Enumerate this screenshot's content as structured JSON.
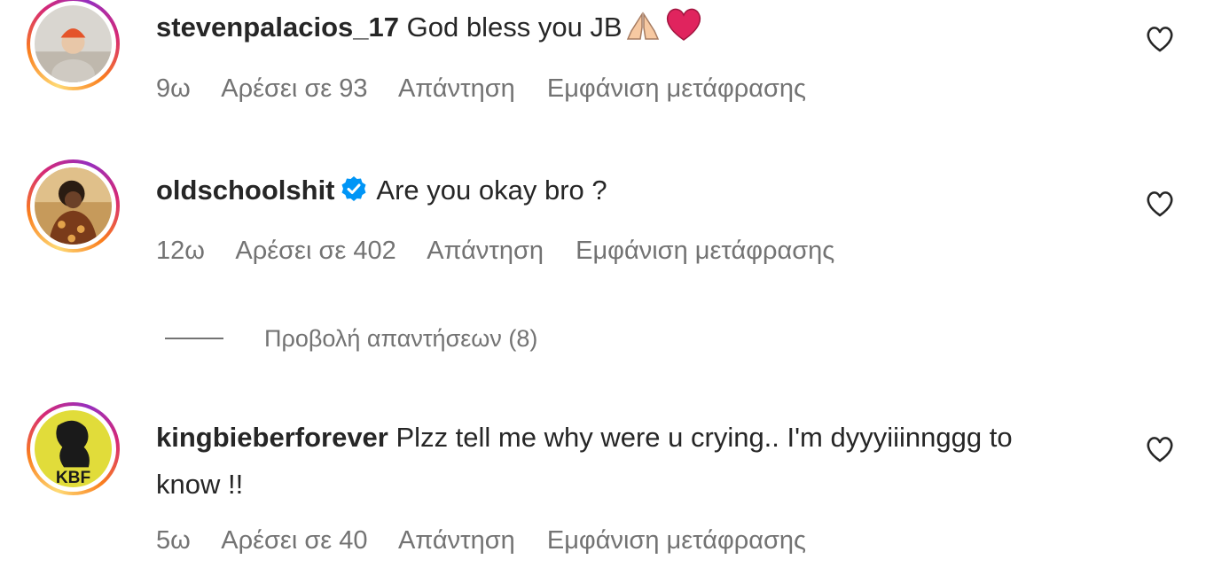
{
  "comments": [
    {
      "username": "stevenpalacios_17",
      "text": "God bless you JB",
      "emoji_icons": [
        "folded-hands-icon",
        "red-heart-icon"
      ],
      "time": "9ω",
      "likes": "Αρέσει σε 93",
      "reply": "Απάντηση",
      "translate": "Εμφάνιση μετάφρασης"
    },
    {
      "username": "oldschoolshit",
      "verified": true,
      "text": "Are you okay bro ?",
      "time": "12ω",
      "likes": "Αρέσει σε 402",
      "reply": "Απάντηση",
      "translate": "Εμφάνιση μετάφρασης"
    },
    {
      "username": "kingbieberforever",
      "text": "Plzz tell me why were u crying.. I'm dyyyiiinnggg to know !!",
      "avatar_text": "KBF",
      "time": "5ω",
      "likes": "Αρέσει σε 40",
      "reply": "Απάντηση",
      "translate": "Εμφάνιση μετάφρασης"
    }
  ],
  "view_replies": "Προβολή απαντήσεων (8)",
  "colors": {
    "text": "#262626",
    "secondary": "#737373",
    "verified": "#0095f6",
    "emoji_heart": "#e0245e"
  }
}
